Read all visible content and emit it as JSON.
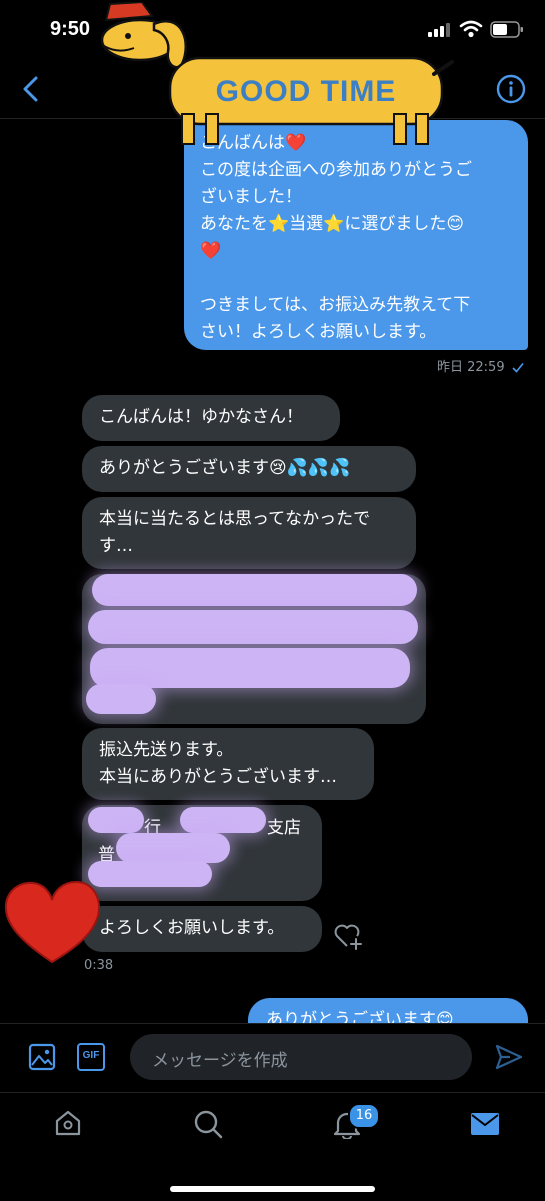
{
  "status_bar": {
    "time": "9:50"
  },
  "sticker": {
    "text": "GOOD TIME"
  },
  "messages": {
    "sent_1": "こんばんは❤️\nこの度は企画への参加ありがとうご\nざいました！\nあなたを⭐当選⭐に選びました😊\n❤️\n\nつきましては、お振込み先教えて下\nさい！よろしくお願いします。",
    "sent_1_time": "昨日 22:59",
    "recv_1": "こんばんは！ゆかなさん！",
    "recv_2": "ありがとうございます😢💦💦💦",
    "recv_3": "本当に当たるとは思ってなかったで\nす…",
    "recv_5": "振込先送ります。\n本当にありがとうございます…",
    "recv_6_a": "行",
    "recv_6_b": "支店",
    "recv_6_c": "普",
    "recv_7": "よろしくお願いします。",
    "recv_7_time": "0:38",
    "sent_2": "ありがとうございます😊"
  },
  "composer": {
    "gif_label": "GIF",
    "placeholder": "メッセージを作成"
  },
  "tabbar": {
    "notification_count": "16"
  },
  "colors": {
    "accent": "#4b98ea",
    "incoming_bubble": "#31363a",
    "background": "#000000",
    "redaction": "#cdb4f5"
  }
}
